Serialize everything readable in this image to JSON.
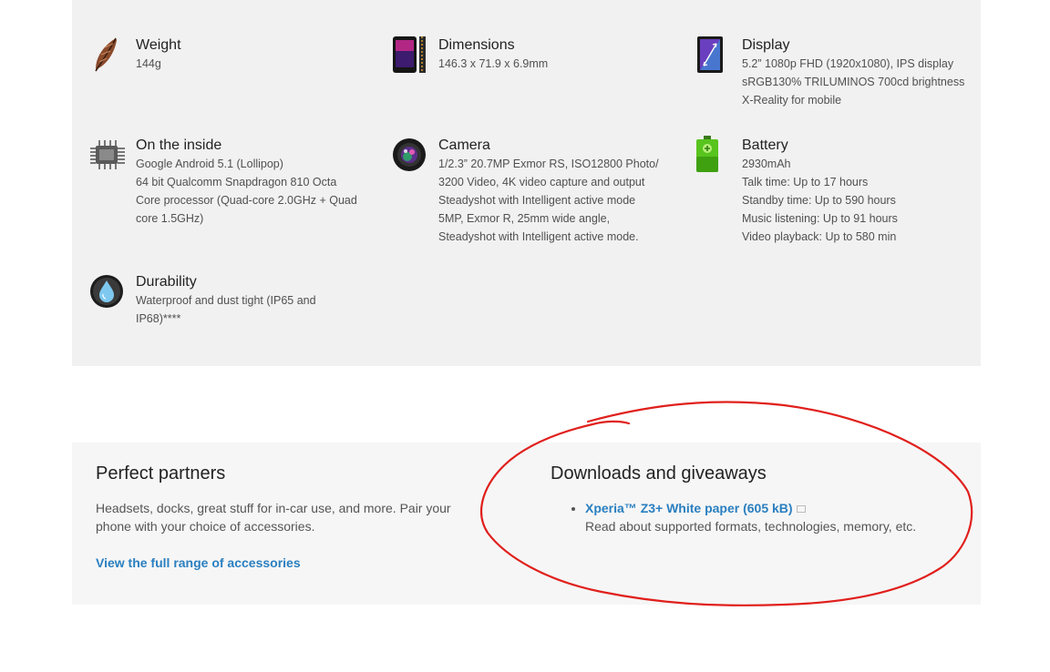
{
  "specs": {
    "weight": {
      "title": "Weight",
      "lines": [
        "144g"
      ]
    },
    "dimensions": {
      "title": "Dimensions",
      "lines": [
        "146.3 x 71.9 x 6.9mm"
      ]
    },
    "display": {
      "title": "Display",
      "lines": [
        "5.2” 1080p FHD (1920x1080), IPS display",
        "sRGB130% TRILUMINOS 700cd brightness",
        "X-Reality for mobile"
      ]
    },
    "inside": {
      "title": "On the inside",
      "lines": [
        "Google Android 5.1 (Lollipop)",
        "64 bit Qualcomm Snapdragon 810 Octa",
        "Core processor (Quad-core 2.0GHz + Quad",
        "core 1.5GHz)"
      ]
    },
    "camera": {
      "title": "Camera",
      "lines": [
        "1/2.3” 20.7MP Exmor RS, ISO12800 Photo/",
        "3200 Video, 4K video capture and output",
        "Steadyshot with Intelligent active mode",
        "5MP, Exmor R, 25mm wide angle,",
        "Steadyshot with Intelligent active mode."
      ]
    },
    "battery": {
      "title": "Battery",
      "lines": [
        "2930mAh",
        "Talk time: Up to 17 hours",
        "Standby time: Up to 590 hours",
        "Music listening: Up to 91 hours",
        "Video playback: Up to 580 min"
      ]
    },
    "durability": {
      "title": "Durability",
      "lines": [
        "Waterproof and dust tight (IP65 and",
        "IP68)****"
      ]
    }
  },
  "partners": {
    "title": "Perfect partners",
    "description": "Headsets, docks, great stuff for in-car use, and more. Pair your phone with your choice of accessories.",
    "link_label": "View the full range of accessories"
  },
  "downloads": {
    "title": "Downloads and giveaways",
    "items": [
      {
        "label": "Xperia™ Z3+ White paper (605 kB)",
        "description": "Read about supported formats, technologies, memory, etc."
      }
    ]
  },
  "annotation": {
    "color": "#e0201c"
  },
  "icons": [
    "feather-icon",
    "phone-icon",
    "display-icon",
    "chip-icon",
    "camera-lens-icon",
    "battery-icon",
    "water-drop-icon",
    "external-file-icon"
  ]
}
